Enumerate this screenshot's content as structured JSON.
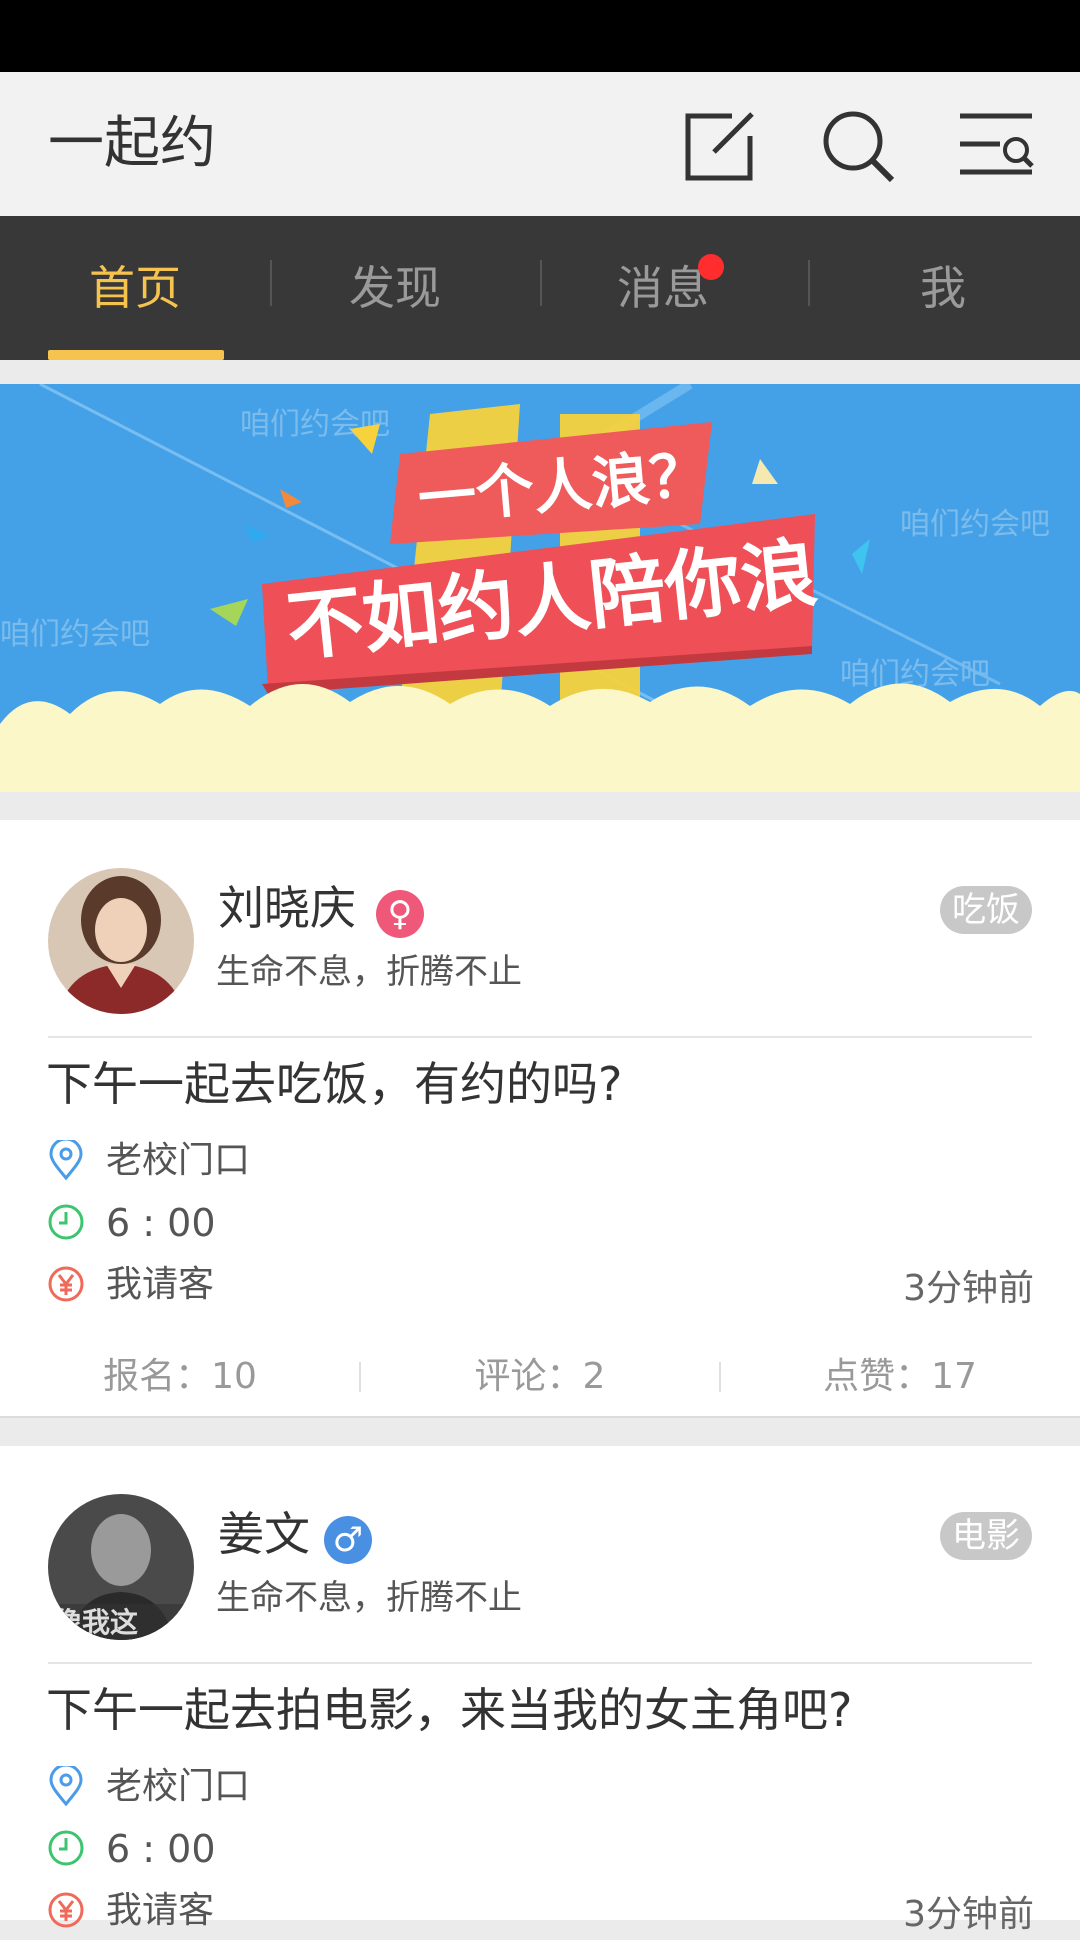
{
  "header": {
    "title": "一起约",
    "icons": [
      "compose-icon",
      "search-icon",
      "menu-search-icon"
    ]
  },
  "tabs": [
    {
      "label": "首页",
      "active": true
    },
    {
      "label": "发现",
      "active": false
    },
    {
      "label": "消息",
      "active": false,
      "badge_dot": true
    },
    {
      "label": "我",
      "active": false
    }
  ],
  "banner": {
    "line1": "一个人浪？",
    "line2": "不如约人陪你浪",
    "watermark": "咱们约会吧"
  },
  "posts": [
    {
      "user": "刘晓庆",
      "gender": "female",
      "gender_symbol": "♀",
      "motto": "生命不息，折腾不止",
      "category": "吃饭",
      "title": "下午一起去吃饭，有约的吗?",
      "location": "老校门口",
      "time": "6 : 00",
      "payment": "我请客",
      "time_ago": "3分钟前",
      "signups": "报名：10",
      "comments": "评论：2",
      "likes": "点赞：17"
    },
    {
      "user": "姜文",
      "gender": "male",
      "gender_symbol": "♂",
      "motto": "生命不息，折腾不止",
      "category": "电影",
      "title": "下午一起去拍电影，来当我的女主角吧?",
      "location": "老校门口",
      "time": "6 : 00",
      "payment": "我请客",
      "time_ago": "3分钟前",
      "avatar_text": "像我这"
    }
  ],
  "colors": {
    "accent": "#f5c34e",
    "tabbar": "#383838",
    "female": "#f0587a",
    "male": "#4a90e2",
    "location_icon": "#4a9be8",
    "time_icon": "#3cc46e",
    "money_icon": "#f06a5a"
  }
}
